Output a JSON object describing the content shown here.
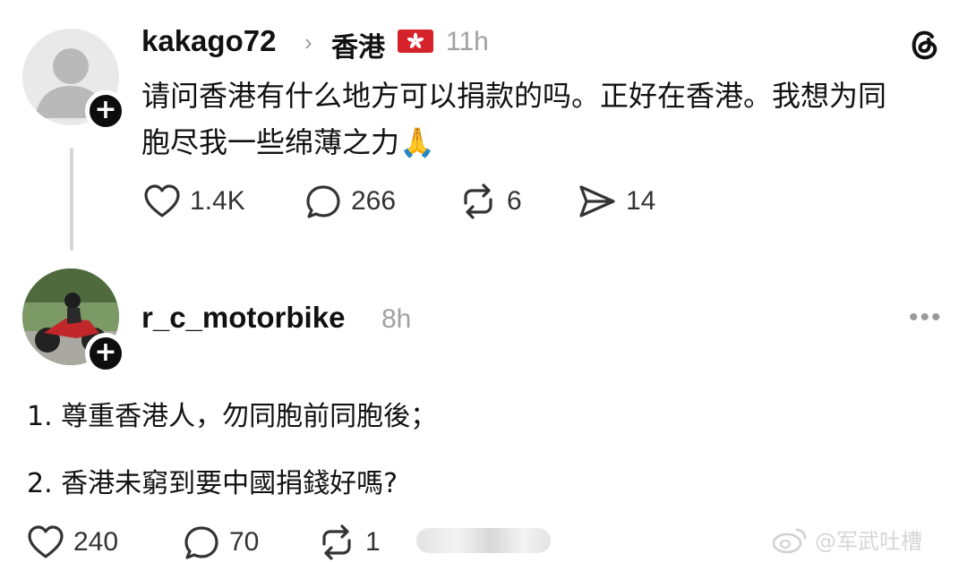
{
  "post": {
    "username": "kakago72",
    "chevron": "›",
    "location": "香港",
    "time": "11h",
    "text_line1": "请问香港有什么地方可以捐款的吗。正好在香港。我想为同",
    "text_line2": "胞尽我一些绵薄之力",
    "emoji": "🙏",
    "likes": "1.4K",
    "comments": "266",
    "reposts": "6",
    "shares": "14",
    "follow_label": "+"
  },
  "reply": {
    "username": "r_c_motorbike",
    "time": "8h",
    "line1": "1. 尊重香港人，勿同胞前同胞後；",
    "line2": "2. 香港未窮到要中國捐錢好嗎?",
    "likes": "240",
    "comments": "70",
    "reposts": "1",
    "more": "•••",
    "follow_label": "+"
  },
  "watermark": {
    "text": "@军武吐槽"
  },
  "icons": {
    "like": "heart-icon",
    "comment": "comment-icon",
    "repost": "repost-icon",
    "share": "share-icon",
    "brand": "threads-logo-icon",
    "flag": "hong-kong-flag-icon"
  },
  "colors": {
    "text": "#111111",
    "muted": "#a0a0a0",
    "badge": "#0d0d0d",
    "flag_red": "#d6232b",
    "thread_line": "#d6d6d6"
  }
}
